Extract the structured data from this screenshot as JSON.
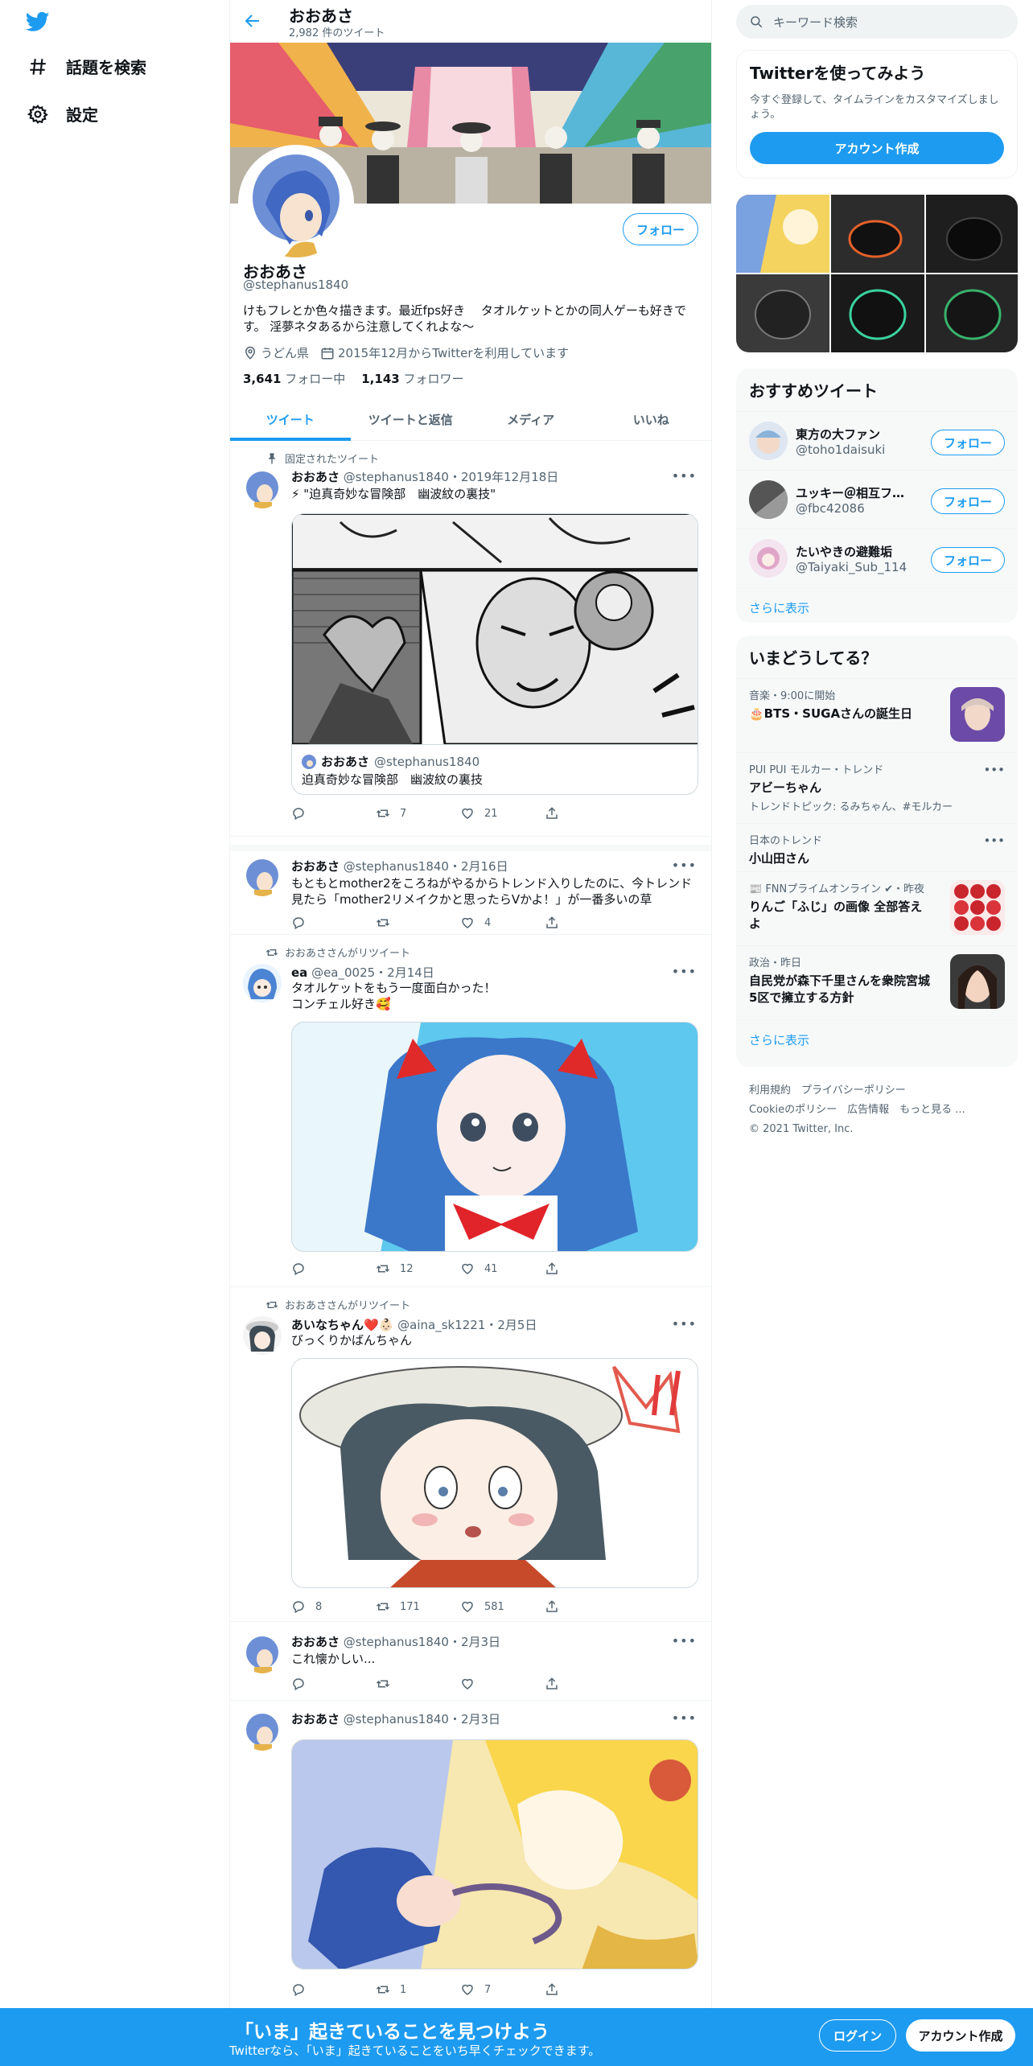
{
  "nav": {
    "explore_label": "話題を検索",
    "settings_label": "設定"
  },
  "header": {
    "title": "おおあさ",
    "tweet_count": "2,982 件のツイート"
  },
  "profile": {
    "follow_label": "フォロー",
    "name": "おおあさ",
    "handle": "@stephanus1840",
    "bio": "けもフレとか色々描きます。最近fps好き　 タオルケットとかの同人ゲーも好きです。 淫夢ネタあるから注意してくれよな〜",
    "location": "うどん県",
    "joined": "2015年12月からTwitterを利用しています",
    "following_count": "3,641",
    "following_label": "フォロー中",
    "followers_count": "1,143",
    "followers_label": "フォロワー"
  },
  "tabs": [
    {
      "label": "ツイート"
    },
    {
      "label": "ツイートと返信"
    },
    {
      "label": "メディア"
    },
    {
      "label": "いいね"
    }
  ],
  "tweets": [
    {
      "context": "固定されたツイート",
      "name": "おおあさ",
      "meta": "@stephanus1840・2019年12月18日",
      "text": "⚡ \"迫真奇妙な冒険部　幽波紋の裏技\"",
      "card_name": "おおあさ",
      "card_handle": "@stephanus1840",
      "card_text": "迫真奇妙な冒険部　幽波紋の裏技",
      "replies": "",
      "retweets": "7",
      "likes": "21"
    },
    {
      "name": "おおあさ",
      "meta": "@stephanus1840・2月16日",
      "text": "もともとmother2をころねがやるからトレンド入りしたのに、今トレンド見たら「mother2リメイクかと思ったらVかよ！」が一番多いの草",
      "replies": "",
      "retweets": "",
      "likes": "4"
    },
    {
      "context": "おおあささんがリツイート",
      "name": "ea",
      "meta": "@ea_0025・2月14日",
      "text": "タオルケットをもう一度面白かった！\nコンチェル好き🥰",
      "replies": "",
      "retweets": "12",
      "likes": "41"
    },
    {
      "context": "おおあささんがリツイート",
      "name": "あいなちゃん❤️👶🏻",
      "meta": "@aina_sk1221・2月5日",
      "text": "びっくりかばんちゃん",
      "replies": "8",
      "retweets": "171",
      "likes": "581"
    },
    {
      "name": "おおあさ",
      "meta": "@stephanus1840・2月3日",
      "text": "これ懐かしい...",
      "replies": "",
      "retweets": "",
      "likes": ""
    },
    {
      "name": "おおあさ",
      "meta": "@stephanus1840・2月3日",
      "text": "",
      "replies": "",
      "retweets": "1",
      "likes": "7"
    }
  ],
  "sidebar": {
    "search_placeholder": "キーワード検索",
    "signup_title": "Twitterを使ってみよう",
    "signup_sub": "今すぐ登録して、タイムラインをカスタマイズしましょう。",
    "signup_button": "アカウント作成",
    "who_title": "おすすめツイート",
    "who": [
      {
        "name": "東方の大ファン",
        "handle": "@toho1daisuki",
        "button": "フォロー"
      },
      {
        "name": "ユッキー＠相互フォ...",
        "handle": "@fbc42086",
        "button": "フォロー"
      },
      {
        "name": "たいやきの避難垢",
        "handle": "@Taiyaki_Sub_114",
        "button": "フォロー"
      }
    ],
    "who_more": "さらに表示",
    "trends_title": "いまどうしてる？",
    "trends": [
      {
        "meta": "音楽・9:00に開始",
        "name": "🎂BTS・SUGAさんの誕生日",
        "sub": ""
      },
      {
        "meta": "PUI PUI モルカー・トレンド",
        "name": "アビーちゃん",
        "sub": "トレンドトピック: るみちゃん、#モルカー"
      },
      {
        "meta": "日本のトレンド",
        "name": "小山田さん",
        "sub": ""
      },
      {
        "meta": "📰 FNNプライムオンライン ✔・昨夜",
        "name": "りんご「ふじ」の画像 全部答えよ",
        "sub": ""
      },
      {
        "meta": "政治・昨日",
        "name": "自民党が森下千里さんを衆院宮城5区で擁立する方針",
        "sub": ""
      }
    ],
    "trends_more": "さらに表示",
    "footer_line1": "利用規約　プライバシーポリシー",
    "footer_line2": "Cookieのポリシー　広告情報　もっと見る ...",
    "footer_line3": "© 2021 Twitter, Inc."
  },
  "bottombar": {
    "title": "「いま」起きていることを見つけよう",
    "sub": "Twitterなら、「いま」起きていることをいち早くチェックできます。",
    "login": "ログイン",
    "signup": "アカウント作成"
  },
  "colors": {
    "accent": "#1d9bf0",
    "text": "#0f1419",
    "secondary": "#536471"
  }
}
